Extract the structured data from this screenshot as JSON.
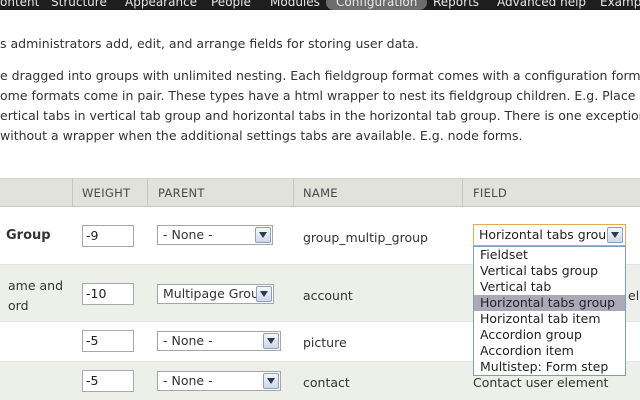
{
  "nav": {
    "items": [
      "ontent",
      "Structure",
      "Appearance",
      "People",
      "Modules",
      "Configuration",
      "Reports",
      "Advanced help",
      "Examp"
    ],
    "active": "Configuration"
  },
  "intro": {
    "line1": "s administrators add, edit, and arrange fields for storing user data.",
    "line2": "e dragged into groups with unlimited nesting. Each fieldgroup format comes with a configuration form",
    "line3": "ome formats come in pair. These types have a html wrapper to nest its fieldgroup children. E.g. Place a",
    "line4": "ertical tabs in vertical tab group and horizontal tabs in the horizontal tab group. There is one exception",
    "line5": "without a wrapper when the additional settings tabs are available. E.g. node forms."
  },
  "table": {
    "headers": {
      "weight": "WEIGHT",
      "parent": "PARENT",
      "name": "NAME",
      "field": "FIELD"
    },
    "rows": [
      {
        "label": "Group",
        "weight": "-9",
        "parent": "- None -",
        "name": "group_multip_group",
        "field": "Horizontal tabs group"
      },
      {
        "label_line1": "ame and",
        "label_line2": "ord",
        "weight": "-10",
        "parent": "Multipage Group",
        "name": "account",
        "field_edge": "el"
      },
      {
        "weight": "-5",
        "parent": "- None -",
        "name": "picture"
      },
      {
        "weight": "-5",
        "parent": "- None -",
        "name": "contact",
        "field": "Contact user element"
      }
    ]
  },
  "dropdown": {
    "options": [
      "Fieldset",
      "Vertical tabs group",
      "Vertical tab",
      "Horizontal tabs group",
      "Horizontal tab item",
      "Accordion group",
      "Accordion item",
      "Multistep: Form step"
    ],
    "selected": "Horizontal tabs group"
  },
  "icons": {
    "select_arrow": "chevron-down-icon"
  }
}
